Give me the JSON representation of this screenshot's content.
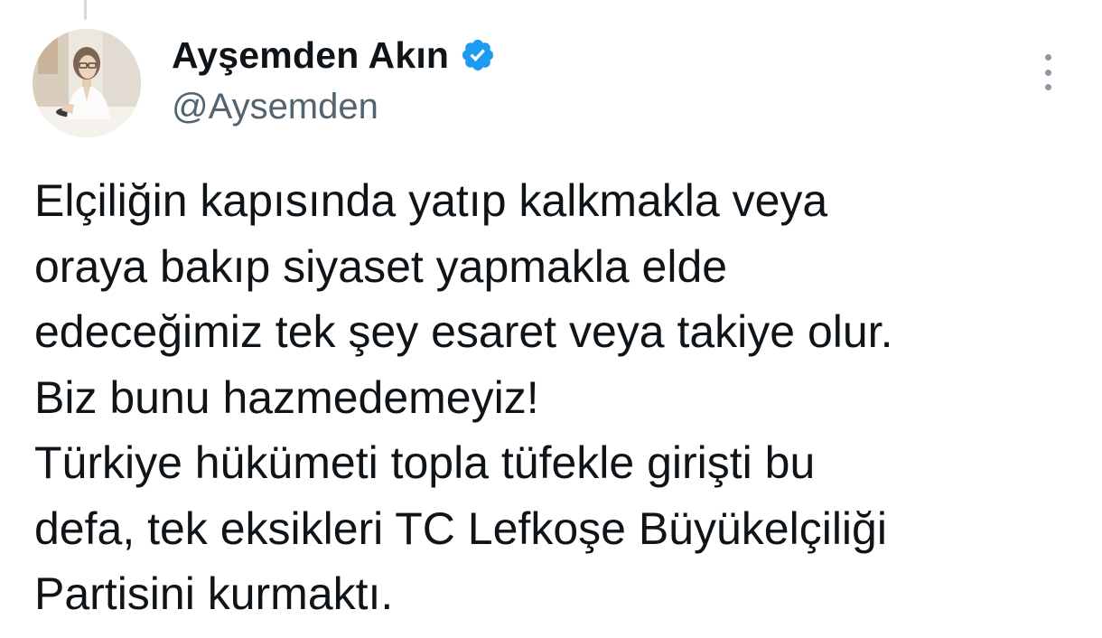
{
  "author": {
    "display_name": "Ayşemden Akın",
    "handle": "@Aysemden",
    "verified_icon": "verified-badge-icon",
    "avatar": "profile-photo"
  },
  "menu": {
    "icon": "more-vertical-icon"
  },
  "tweet": {
    "lines": [
      "Elçiliğin kapısında yatıp kalkmakla veya",
      "oraya bakıp siyaset yapmakla elde",
      "edeceğimiz tek şey esaret veya takiye olur.",
      "Biz bunu hazmedemeyiz!",
      "Türkiye hükümeti topla tüfekle girişti bu",
      "defa, tek eksikleri TC Lefkoşe Büyükelçiliği",
      "Partisini kurmaktı."
    ]
  },
  "colors": {
    "verified_blue": "#1d9bf0",
    "text_primary": "#0f1419",
    "text_secondary": "#536471",
    "thread_line": "#cfd9de"
  }
}
